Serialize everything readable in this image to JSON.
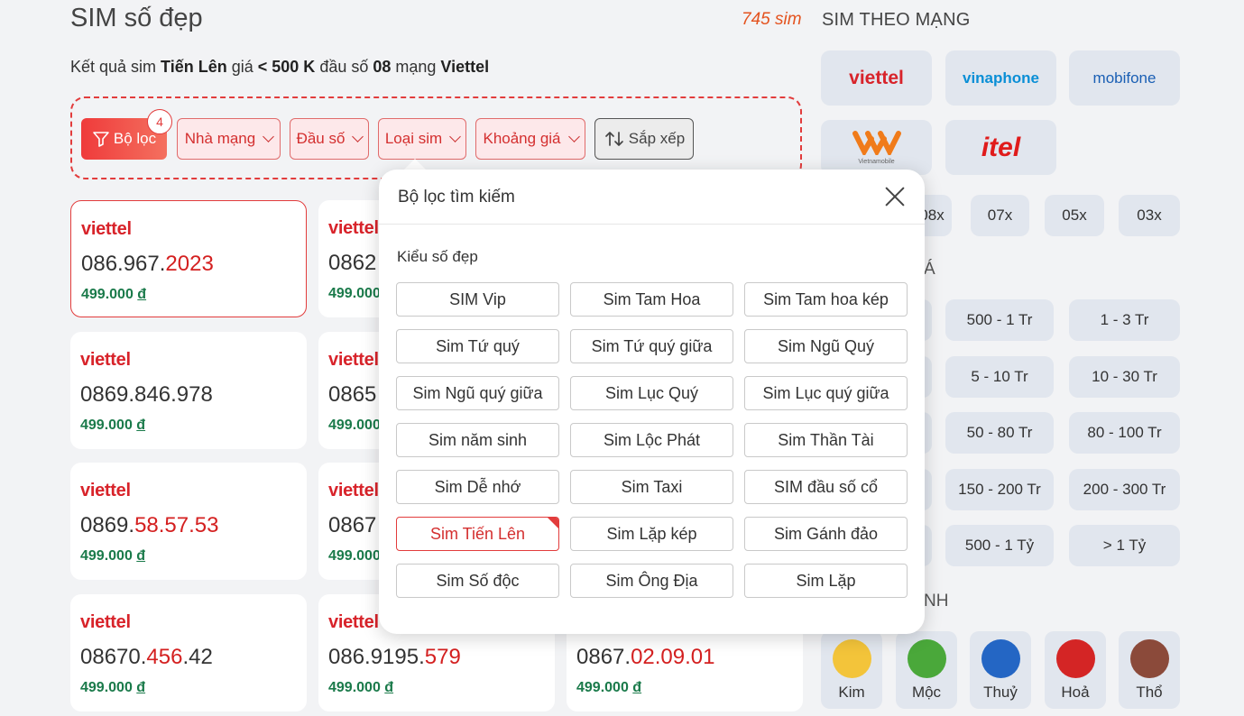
{
  "header": {
    "title": "SIM số đẹp",
    "result_prefix": "Kết quả sim ",
    "result_type": "Tiến Lên",
    "result_mid1": " giá ",
    "result_price": "< 500 K",
    "result_mid2": " đầu số ",
    "result_prefixnum": "08",
    "result_mid3": " mạng ",
    "result_network": "Viettel"
  },
  "filters": {
    "main_label": "Bộ lọc",
    "badge_count": "4",
    "network_label": "Nhà mạng",
    "prefix_label": "Đầu số",
    "type_label": "Loại sim",
    "price_label": "Khoảng giá",
    "sort_label": "Sắp xếp"
  },
  "sims": [
    {
      "logo": "viettel",
      "num_plain": "086.967.",
      "num_hl": "2023",
      "num_tail": "",
      "price": "499.000",
      "currency": "đ"
    },
    {
      "logo": "viettel",
      "num_plain": "0862",
      "num_hl": "",
      "num_tail": "",
      "price": "499.000",
      "currency": "đ"
    },
    {
      "logo": "viettel",
      "num_plain": "0869.846.978",
      "num_hl": "",
      "num_tail": "",
      "price": "499.000",
      "currency": "đ"
    },
    {
      "logo": "viettel",
      "num_plain": "0865",
      "num_hl": "",
      "num_tail": "",
      "price": "499.000",
      "currency": "đ"
    },
    {
      "logo": "viettel",
      "num_plain": "0869.",
      "num_hl": "58.57.53",
      "num_tail": "",
      "price": "499.000",
      "currency": "đ"
    },
    {
      "logo": "viettel",
      "num_plain": "0867",
      "num_hl": "",
      "num_tail": "",
      "price": "499.000",
      "currency": "đ"
    },
    {
      "logo": "viettel",
      "num_plain": "08670.",
      "num_hl": "456",
      "num_tail": ".42",
      "price": "499.000",
      "currency": "đ"
    },
    {
      "logo": "viettel",
      "num_plain": "086.9195.",
      "num_hl": "579",
      "num_tail": "",
      "price": "499.000",
      "currency": "đ"
    },
    {
      "logo": "",
      "num_plain": "0867.",
      "num_hl": "02.09.01",
      "num_tail": "",
      "price": "499.000",
      "currency": "đ"
    }
  ],
  "sidebar": {
    "count": "745 sim",
    "network_title": "SIM THEO MẠNG",
    "networks": [
      "viettel",
      "vinaphone",
      "mobifone",
      "Vietnamobile",
      "itel"
    ],
    "network_colors": {
      "viettel": "#d8232a",
      "vinaphone": "#0a8fd6",
      "mobifone": "#1a5fb4",
      "itel": "#e01b1b"
    },
    "prefixes": [
      "08x",
      "07x",
      "05x",
      "03x"
    ],
    "price_title_tail": "Á",
    "prices": [
      "500 - 1 Tr",
      "1 - 3 Tr",
      "5 - 10 Tr",
      "10 - 30 Tr",
      "50 - 80 Tr",
      "80 - 100 Tr",
      "150 - 200 Tr",
      "200 - 300 Tr",
      "500 - 1 Tỷ",
      "> 1 Tỷ"
    ],
    "element_title_tail": "NH",
    "elements": [
      "Kim",
      "Mộc",
      "Thuỷ",
      "Hoả",
      "Thổ"
    ]
  },
  "popup": {
    "title": "Bộ lọc tìm kiếm",
    "section_title": "Kiểu số đẹp",
    "options": [
      "SIM Vip",
      "Sim Tam Hoa",
      "Sim Tam hoa kép",
      "Sim Tứ quý",
      "Sim Tứ quý giữa",
      "Sim Ngũ Quý",
      "Sim Ngũ quý giữa",
      "Sim Lục Quý",
      "Sim Lục quý giữa",
      "Sim năm sinh",
      "Sim Lộc Phát",
      "Sim Thần Tài",
      "Sim Dễ nhớ",
      "Sim Taxi",
      "SIM đầu số cổ",
      "Sim Tiến Lên",
      "Sim Lặp kép",
      "Sim Gánh đảo",
      "Sim Số độc",
      "Sim Ông Địa",
      "Sim Lặp"
    ],
    "selected": "Sim Tiến Lên"
  }
}
